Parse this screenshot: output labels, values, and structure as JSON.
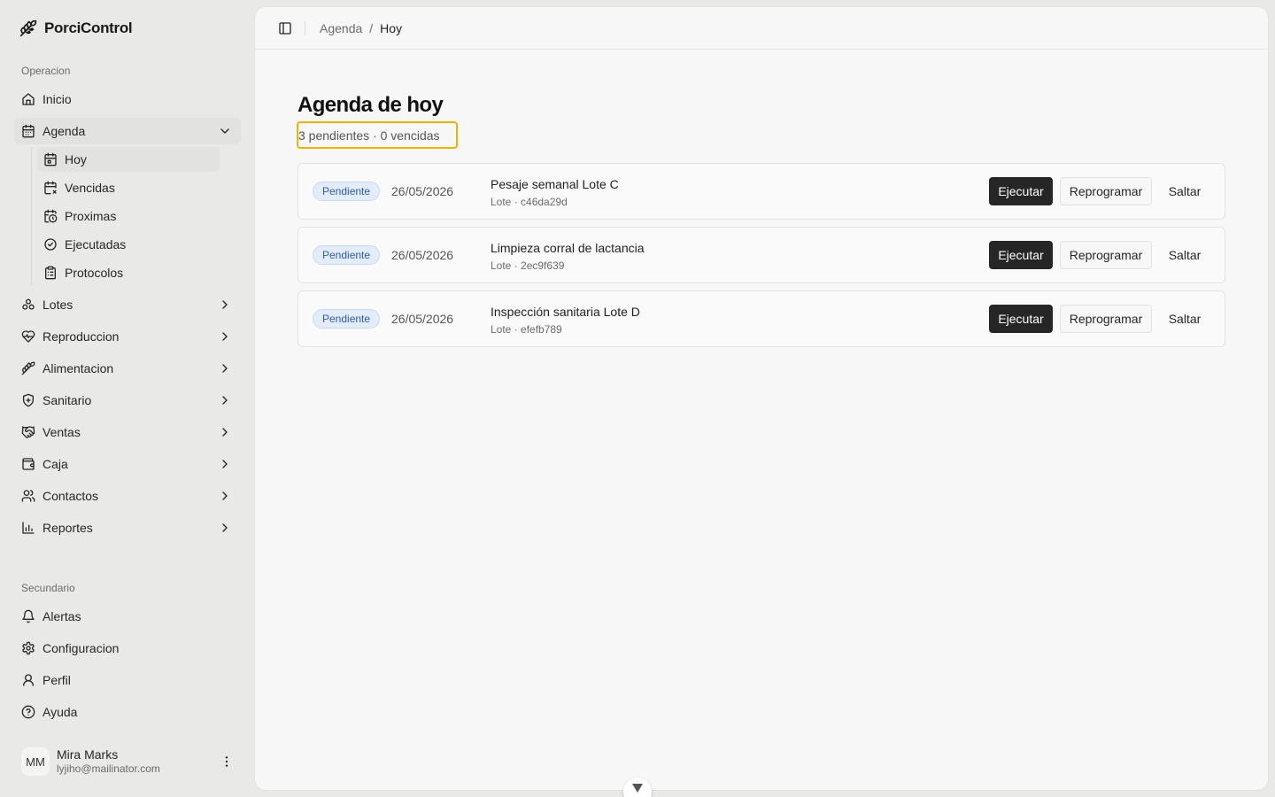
{
  "app": {
    "name": "PorciControl"
  },
  "sidebar": {
    "group_operacion": "Operacion",
    "group_secundario": "Secundario",
    "items": {
      "inicio": "Inicio",
      "agenda": "Agenda",
      "lotes": "Lotes",
      "reproduccion": "Reproduccion",
      "alimentacion": "Alimentacion",
      "sanitario": "Sanitario",
      "ventas": "Ventas",
      "caja": "Caja",
      "contactos": "Contactos",
      "reportes": "Reportes"
    },
    "agenda_sub": {
      "hoy": "Hoy",
      "vencidas": "Vencidas",
      "proximas": "Proximas",
      "ejecutadas": "Ejecutadas",
      "protocolos": "Protocolos"
    },
    "secondary": {
      "alertas": "Alertas",
      "configuracion": "Configuracion",
      "perfil": "Perfil",
      "ayuda": "Ayuda"
    },
    "user": {
      "initials": "MM",
      "name": "Mira Marks",
      "email": "lyjiho@mailinator.com"
    }
  },
  "breadcrumb": {
    "parent": "Agenda",
    "separator": "/",
    "current": "Hoy"
  },
  "page": {
    "title": "Agenda de hoy",
    "summary": "3 pendientes · 0 vencidas"
  },
  "actions": {
    "execute": "Ejecutar",
    "reschedule": "Reprogramar",
    "skip": "Saltar"
  },
  "tasks": [
    {
      "status": "Pendiente",
      "date": "26/05/2026",
      "title": "Pesaje semanal Lote C",
      "sub": "Lote · c46da29d"
    },
    {
      "status": "Pendiente",
      "date": "26/05/2026",
      "title": "Limpieza corral de lactancia",
      "sub": "Lote · 2ec9f639"
    },
    {
      "status": "Pendiente",
      "date": "26/05/2026",
      "title": "Inspección sanitaria Lote D",
      "sub": "Lote · efefb789"
    }
  ],
  "colors": {
    "primary_button": "#262626",
    "badge_bg": "#e3ecfb",
    "badge_text": "#2e5bb7",
    "highlight": "#f0b400"
  }
}
